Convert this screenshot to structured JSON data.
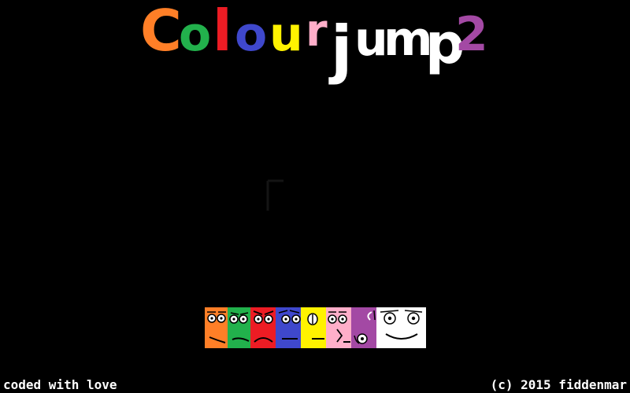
{
  "title": {
    "letters": [
      {
        "char": "C",
        "color": "#ff7f27"
      },
      {
        "char": "o",
        "color": "#22b14c"
      },
      {
        "char": "l",
        "color": "#ed1c24"
      },
      {
        "char": "o",
        "color": "#3f48cc"
      },
      {
        "char": "u",
        "color": "#fff200"
      },
      {
        "char": "r",
        "color": "#ffaec9"
      },
      {
        "char": "j",
        "color": "#ffffff"
      },
      {
        "char": "u",
        "color": "#ffffff"
      },
      {
        "char": "m",
        "color": "#ffffff"
      },
      {
        "char": "p",
        "color": "#ffffff"
      },
      {
        "char": "2",
        "color": "#a349a4"
      }
    ]
  },
  "characters": [
    {
      "name": "orange-face",
      "color": "#ff7f27"
    },
    {
      "name": "green-face",
      "color": "#22b14c"
    },
    {
      "name": "red-face",
      "color": "#ed1c24"
    },
    {
      "name": "blue-face",
      "color": "#3f48cc"
    },
    {
      "name": "yellow-face",
      "color": "#fff200"
    },
    {
      "name": "pink-face",
      "color": "#ffaec9"
    },
    {
      "name": "purple-face",
      "color": "#a349a4"
    },
    {
      "name": "white-face",
      "color": "#ffffff"
    }
  ],
  "footer": {
    "left": "coded with love",
    "right": "(c) 2015 fiddenmar"
  }
}
